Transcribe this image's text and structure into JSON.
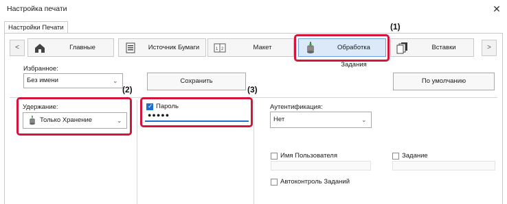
{
  "window": {
    "title": "Настройка печати",
    "close_glyph": "✕"
  },
  "tabs": [
    {
      "label": "Настройки Печати"
    }
  ],
  "nav": {
    "prev": "<",
    "next": ">"
  },
  "toolbar": [
    {
      "label": "Главные",
      "icon": "home-icon"
    },
    {
      "label": "Источник Бумаги",
      "icon": "paper-tray-icon"
    },
    {
      "label": "Макет",
      "icon": "layout-icon"
    },
    {
      "label": "Обработка Задания",
      "icon": "job-storage-icon"
    },
    {
      "label": "Вставки",
      "icon": "inserts-icon"
    }
  ],
  "favorites": {
    "label": "Избранное:",
    "value": "Без имени",
    "save": "Сохранить"
  },
  "defaults_button": "По умолчанию",
  "retention": {
    "label": "Удержание:",
    "value": "Только Хранение"
  },
  "password": {
    "label": "Пароль",
    "checked": true,
    "value": "●●●●●"
  },
  "auth": {
    "label": "Аутентификация:",
    "value": "Нет"
  },
  "username": {
    "label": "Имя Пользователя"
  },
  "jobname": {
    "label": "Задание"
  },
  "autojob": {
    "label": "Автоконтроль Заданий"
  },
  "callouts": {
    "c1": "(1)",
    "c2": "(2)",
    "c3": "(3)"
  },
  "colors": {
    "highlight": "#d4143b",
    "accent": "#1a6fcf"
  }
}
